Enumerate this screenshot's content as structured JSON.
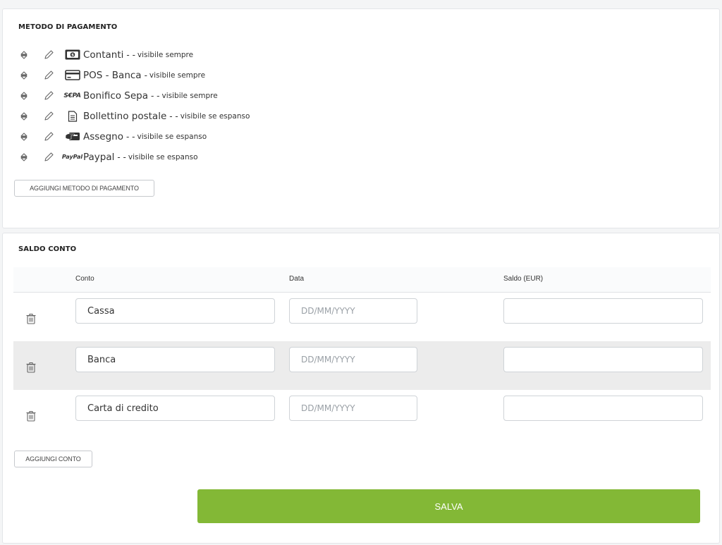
{
  "payment_methods": {
    "title": "METODO DI PAGAMENTO",
    "items": [
      {
        "name": "Contanti",
        "separator": "- -",
        "visibility": "visibile sempre",
        "icon": "cash-icon"
      },
      {
        "name": "POS - Banca",
        "separator": "-",
        "visibility": "visibile sempre",
        "icon": "credit-card-icon"
      },
      {
        "name": "Bonifico Sepa",
        "separator": "- -",
        "visibility": "visibile sempre",
        "icon": "sepa-icon",
        "icon_text": "S€PA"
      },
      {
        "name": "Bollettino postale",
        "separator": "- -",
        "visibility": "visibile se espanso",
        "icon": "document-icon"
      },
      {
        "name": "Assegno",
        "separator": "- -",
        "visibility": "visibile se espanso",
        "icon": "cheque-icon"
      },
      {
        "name": "Paypal",
        "separator": "- -",
        "visibility": "visibile se espanso",
        "icon": "paypal-icon",
        "icon_text": "PayPal"
      }
    ],
    "add_button": "AGGIUNGI METODO DI PAGAMENTO"
  },
  "balance": {
    "title": "SALDO CONTO",
    "columns": [
      "Conto",
      "Data",
      "Saldo (EUR)"
    ],
    "rows": [
      {
        "conto": "Cassa",
        "data": "",
        "saldo": ""
      },
      {
        "conto": "Banca",
        "data": "",
        "saldo": ""
      },
      {
        "conto": "Carta di credito",
        "data": "",
        "saldo": ""
      }
    ],
    "date_placeholder": "DD/MM/YYYY",
    "add_button": "AGGIUNGI CONTO"
  },
  "save_button": "SALVA",
  "colors": {
    "accent": "#83b836",
    "stripe": "#ececec"
  }
}
